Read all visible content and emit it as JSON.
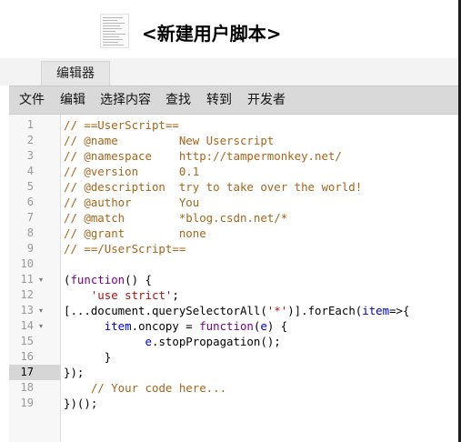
{
  "header": {
    "title": "<新建用户脚本>"
  },
  "tabs": [
    {
      "label": "编辑器"
    }
  ],
  "menubar": {
    "items": [
      "文件",
      "编辑",
      "选择内容",
      "查找",
      "转到",
      "开发者"
    ]
  },
  "editor": {
    "active_line": 17,
    "fold_lines": [
      11,
      13,
      14
    ],
    "lines": [
      [
        {
          "t": "// ==UserScript==",
          "c": "c"
        }
      ],
      [
        {
          "t": "// @name         New Userscript",
          "c": "c"
        }
      ],
      [
        {
          "t": "// @namespace    http://tampermonkey.net/",
          "c": "c"
        }
      ],
      [
        {
          "t": "// @version      0.1",
          "c": "c"
        }
      ],
      [
        {
          "t": "// @description  try to take over the world!",
          "c": "c"
        }
      ],
      [
        {
          "t": "// @author       You",
          "c": "c"
        }
      ],
      [
        {
          "t": "// @match        *blog.csdn.net/*",
          "c": "c"
        }
      ],
      [
        {
          "t": "// @grant        none",
          "c": "c"
        }
      ],
      [
        {
          "t": "// ==/UserScript==",
          "c": "c"
        }
      ],
      [],
      [
        {
          "t": "(",
          "c": "d"
        },
        {
          "t": "function",
          "c": "k"
        },
        {
          "t": "() {",
          "c": "d"
        }
      ],
      [
        {
          "t": "    ",
          "c": "d"
        },
        {
          "t": "'use strict'",
          "c": "s"
        },
        {
          "t": ";",
          "c": "d"
        }
      ],
      [
        {
          "t": "[...document.querySelectorAll(",
          "c": "d"
        },
        {
          "t": "'*'",
          "c": "s"
        },
        {
          "t": ")].forEach(",
          "c": "d"
        },
        {
          "t": "item",
          "c": "v"
        },
        {
          "t": "=>{",
          "c": "d"
        }
      ],
      [
        {
          "t": "      ",
          "c": "d"
        },
        {
          "t": "item",
          "c": "v"
        },
        {
          "t": ".oncopy = ",
          "c": "d"
        },
        {
          "t": "function",
          "c": "k"
        },
        {
          "t": "(",
          "c": "d"
        },
        {
          "t": "e",
          "c": "v"
        },
        {
          "t": ") {",
          "c": "d"
        }
      ],
      [
        {
          "t": "            ",
          "c": "d"
        },
        {
          "t": "e",
          "c": "v"
        },
        {
          "t": ".stopPropagation();",
          "c": "d"
        }
      ],
      [
        {
          "t": "      }",
          "c": "d"
        }
      ],
      [
        {
          "t": "});",
          "c": "d"
        }
      ],
      [
        {
          "t": "    ",
          "c": "d"
        },
        {
          "t": "// Your code here...",
          "c": "c"
        }
      ],
      [
        {
          "t": "})();",
          "c": "d"
        }
      ]
    ]
  }
}
